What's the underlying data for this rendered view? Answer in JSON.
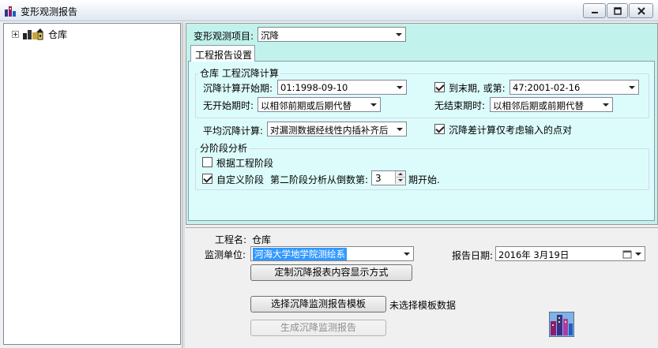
{
  "window": {
    "title": "变形观测报告"
  },
  "tree": {
    "root_label": "仓库"
  },
  "project_select": {
    "label": "变形观测项目:",
    "value": "沉降"
  },
  "tabs": [
    {
      "label": "工程报告设置"
    }
  ],
  "calc_group": {
    "title": "仓库  工程沉降计算",
    "start_label": "沉降计算开始期:",
    "start_value": "01:1998-09-10",
    "end_checkbox_label": "到末期, 或第:",
    "end_checked": true,
    "end_value": "47:2001-02-16",
    "no_start_label": "无开始期时:",
    "no_start_value": "以相邻前期或后期代替",
    "no_end_label": "无结束期时:",
    "no_end_value": "以相邻后期或前期代替"
  },
  "avg_calc": {
    "label": "平均沉降计算:",
    "value": "对漏测数据经线性内插补齐后",
    "diff_checkbox_label": "沉降差计算仅考虑输入的点对",
    "diff_checked": true
  },
  "stage_group": {
    "title": "分阶段分析",
    "by_stage_label": "根据工程阶段",
    "by_stage_checked": false,
    "custom_label": "自定义阶段",
    "custom_checked": true,
    "second_stage_label": "第二阶段分析从倒数第:",
    "second_stage_value": "3",
    "period_suffix": "期开始."
  },
  "report": {
    "project_name_label": "工程名:",
    "project_name_value": "仓库",
    "monitor_unit_label": "监测单位:",
    "monitor_unit_value": "河海大学地学院测绘系",
    "report_date_label": "报告日期:",
    "report_date_value": "2016年  3月19日",
    "customize_button": "定制沉降报表内容显示方式",
    "select_template_button": "选择沉降监测报告模板",
    "template_status": "未选择模板数据",
    "generate_button": "生成沉降监测报告"
  },
  "colors": {
    "panel_bg": "#c2f2ec",
    "tab_page_bg": "#dcfcfc",
    "selection": "#3399ff"
  }
}
